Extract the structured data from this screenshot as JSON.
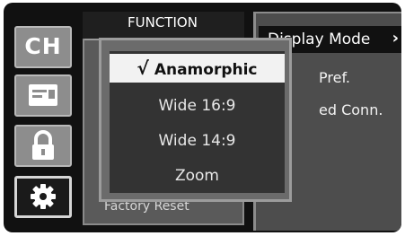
{
  "sidebar": {
    "ch_label": "CH",
    "icons": [
      "channel-icon",
      "input-source-icon",
      "lock-icon",
      "settings-gear-icon"
    ]
  },
  "function_panel": {
    "title": "FUNCTION",
    "last_item": "Factory Reset"
  },
  "right_menu": {
    "items": [
      "Display Mode",
      "Pref.",
      "ed Conn."
    ],
    "highlighted_index": 0
  },
  "popup": {
    "check_mark": "√",
    "options": [
      "Anamorphic",
      "Wide 16:9",
      "Wide 14:9",
      "Zoom"
    ],
    "selected": "Anamorphic"
  }
}
